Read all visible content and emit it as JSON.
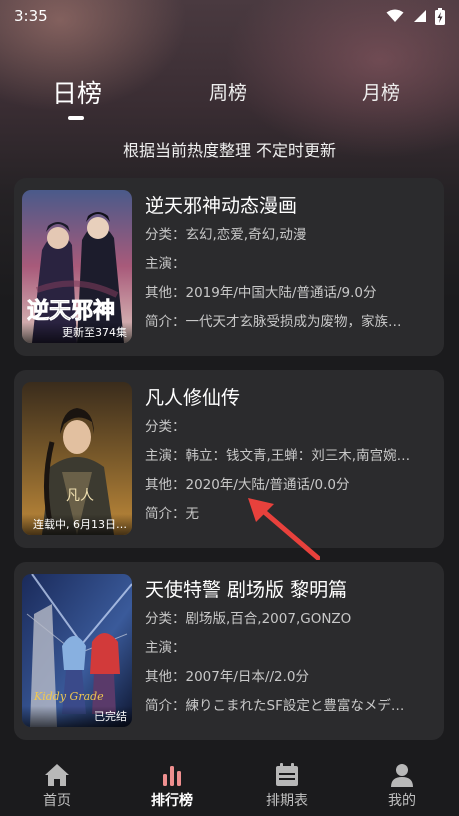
{
  "status_bar": {
    "time": "3:35"
  },
  "tabs": [
    {
      "label": "日榜",
      "active": true
    },
    {
      "label": "周榜",
      "active": false
    },
    {
      "label": "月榜",
      "active": false
    }
  ],
  "subtitle": "根据当前热度整理 不定时更新",
  "items": [
    {
      "title": "逆天邪神动态漫画",
      "category": "分类：玄幻,恋爱,奇幻,动漫",
      "cast": "主演：",
      "other": "其他：2019年/中国大陆/普通话/9.0分",
      "summary": "简介：一代天才玄脉受损成为废物，家族…",
      "badge": "更新至374集",
      "cover_logo": "逆天邪神"
    },
    {
      "title": "凡人修仙传",
      "category": "分类：",
      "cast": "主演：韩立：钱文青,王蝉：刘三木,南宫婉…",
      "other": "其他：2020年/大陆/普通话/0.0分",
      "summary": "简介：无",
      "badge": "连载中, 6月13日…",
      "cover_logo": "凡人"
    },
    {
      "title": "天使特警 剧场版 黎明篇",
      "category": "分类：剧场版,百合,2007,GONZO",
      "cast": "主演：",
      "other": "其他：2007年/日本//2.0分",
      "summary": "简介：練りこまれたSF設定と豊富なメデ…",
      "badge": "已完结",
      "cover_logo": "Kiddy Grade"
    }
  ],
  "bottom_nav": [
    {
      "label": "首页",
      "icon": "home-icon",
      "active": false
    },
    {
      "label": "排行榜",
      "icon": "ranking-icon",
      "active": true
    },
    {
      "label": "排期表",
      "icon": "calendar-icon",
      "active": false
    },
    {
      "label": "我的",
      "icon": "user-icon",
      "active": false
    }
  ],
  "colors": {
    "background": "#1b1b1d",
    "card": "#2b2b2d",
    "arrow": "#e8413c",
    "text_muted": "#c8c8c8"
  }
}
